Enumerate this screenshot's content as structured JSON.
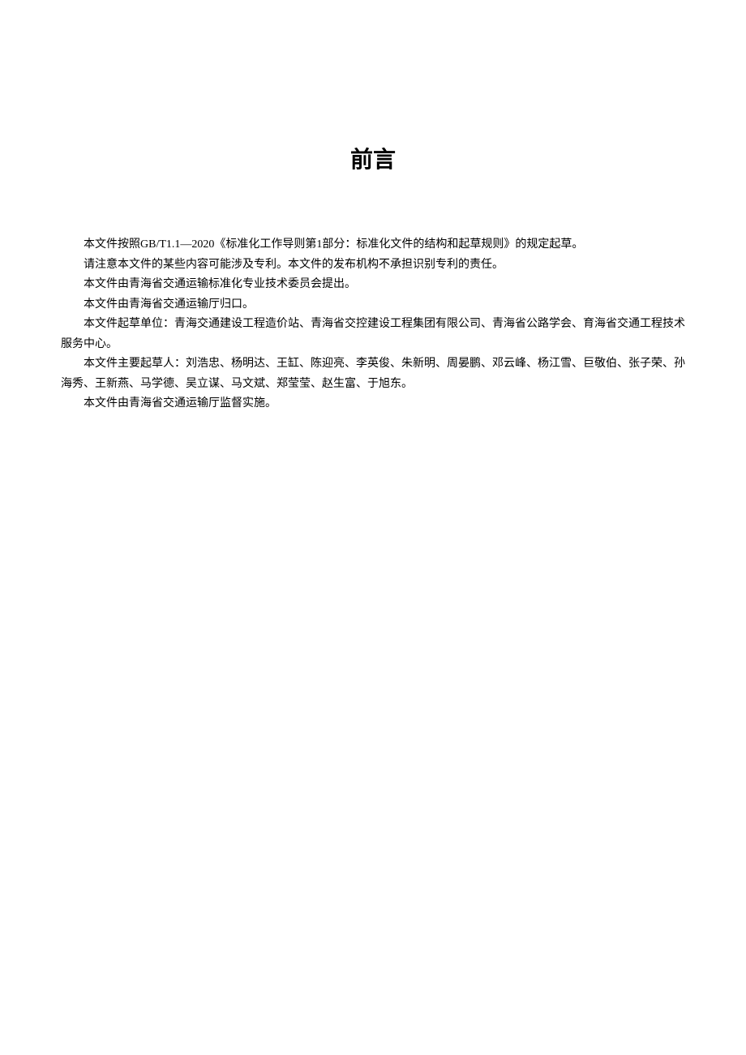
{
  "title": "前言",
  "paragraphs": [
    "本文件按照GB/T1.1—2020《标准化工作导则第1部分：标准化文件的结构和起草规则》的规定起草。",
    "请注意本文件的某些内容可能涉及专利。本文件的发布机构不承担识别专利的责任。",
    "本文件由青海省交通运输标准化专业技术委员会提出。",
    "本文件由青海省交通运输厅归口。",
    "本文件起草单位：青海交通建设工程造价站、青海省交控建设工程集团有限公司、青海省公路学会、育海省交通工程技术服务中心。",
    "本文件主要起草人：刘浩忠、杨明达、王缸、陈迎亮、李英俊、朱新明、周晏鹏、邓云峰、杨江雪、巨敬伯、张子荣、孙海秀、王新燕、马学德、吴立谋、马文斌、郑莹莹、赵生富、于旭东。",
    "本文件由青海省交通运输厅监督实施。"
  ]
}
